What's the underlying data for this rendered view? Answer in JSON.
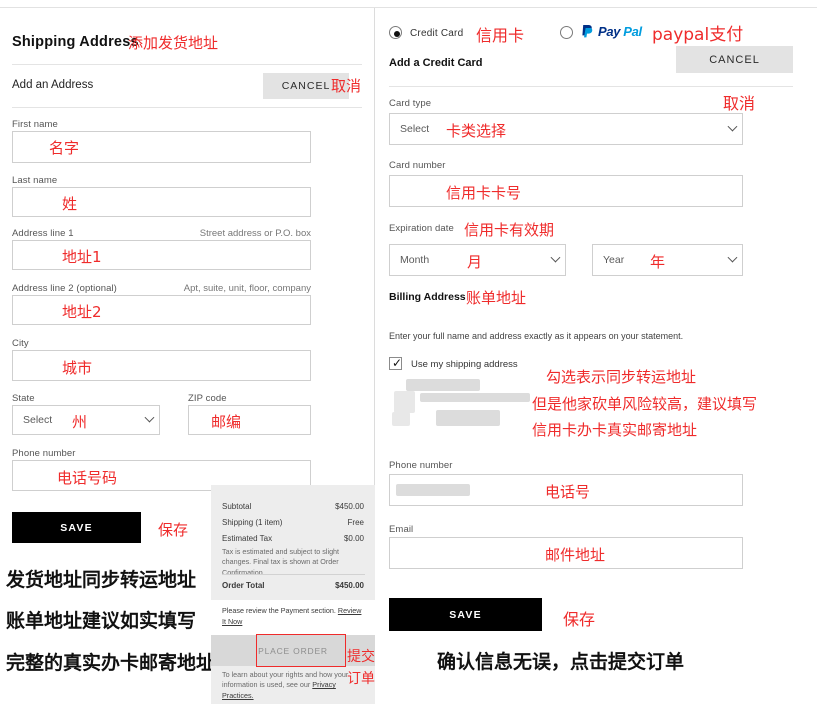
{
  "shipping": {
    "section_title": "Shipping Address",
    "section_title_anno": "添加发货地址",
    "add_address_label": "Add an Address",
    "cancel_label": "CANCEL",
    "cancel_anno": "取消",
    "fields": {
      "first_name": {
        "label": "First name",
        "value": "",
        "anno": "名字"
      },
      "last_name": {
        "label": "Last name",
        "value": "",
        "anno": "姓"
      },
      "address1": {
        "label": "Address line 1",
        "hint": "Street address or P.O. box",
        "value": "",
        "anno": "地址1"
      },
      "address2": {
        "label": "Address line 2 (optional)",
        "hint": "Apt, suite, unit, floor, company",
        "value": "",
        "anno": "地址2"
      },
      "city": {
        "label": "City",
        "value": "",
        "anno": "城市"
      },
      "state": {
        "label": "State",
        "placeholder": "Select",
        "anno": "州"
      },
      "zip": {
        "label": "ZIP code",
        "value": "",
        "anno": "邮编"
      },
      "phone": {
        "label": "Phone number",
        "value": "",
        "anno": "电话号码"
      }
    },
    "save_label": "SAVE",
    "save_anno": "保存"
  },
  "left_notes": {
    "line1": "发货地址同步转运地址",
    "line2": "账单地址建议如实填写",
    "line3": "完整的真实办卡邮寄地址"
  },
  "summary": {
    "subtotal_label": "Subtotal",
    "subtotal_value": "$450.00",
    "shipping_label": "Shipping (1 item)",
    "shipping_value": "Free",
    "tax_label": "Estimated Tax",
    "tax_value": "$0.00",
    "tax_note": "Tax is estimated and subject to slight changes. Final tax is shown at Order Confirmation.",
    "total_label": "Order Total",
    "total_value": "$450.00",
    "review_note": "Please review the Payment section.",
    "review_link": "Review It Now",
    "place_order_label": "PLACE ORDER",
    "place_order_anno_1": "提交",
    "place_order_anno_2": "订单",
    "privacy_note": "To learn about your rights and how your information is used, see our",
    "privacy_link": "Privacy Practices."
  },
  "payment": {
    "credit_card_label": "Credit Card",
    "credit_card_anno": "信用卡",
    "paypal_name_a": "Pay",
    "paypal_name_b": "Pal",
    "paypal_anno": "paypal支付",
    "add_card_label": "Add a Credit Card",
    "cancel_label": "CANCEL",
    "cancel_anno": "取消",
    "fields": {
      "card_type": {
        "label": "Card type",
        "placeholder": "Select",
        "anno": "卡类选择"
      },
      "card_number": {
        "label": "Card number",
        "value": "",
        "anno": "信用卡卡号"
      },
      "expiration": {
        "label": "Expiration date",
        "anno": "信用卡有效期"
      },
      "month": {
        "placeholder": "Month",
        "anno": "月"
      },
      "year": {
        "placeholder": "Year",
        "anno": "年"
      },
      "phone": {
        "label": "Phone number",
        "value": "",
        "anno": "电话号"
      },
      "email": {
        "label": "Email",
        "value": "",
        "anno": "邮件地址"
      }
    },
    "billing_title": "Billing Address",
    "billing_anno": "账单地址",
    "statement_note": "Enter your full name and address exactly as it appears on your statement.",
    "use_shipping_label": "Use my shipping address",
    "use_shipping_anno": "勾选表示同步转运地址",
    "risk_anno_1": "但是他家砍单风险较高，建议填写",
    "risk_anno_2": "信用卡办卡真实邮寄地址",
    "save_label": "SAVE",
    "save_anno": "保存"
  },
  "right_notes": {
    "line1": "确认信息无误，点击提交订单"
  },
  "colors": {
    "annotation_red": "#ef2b2b",
    "button_black": "#000000",
    "cancel_gray": "#e3e3e3",
    "paypal_dark": "#003087",
    "paypal_light": "#009cde"
  }
}
